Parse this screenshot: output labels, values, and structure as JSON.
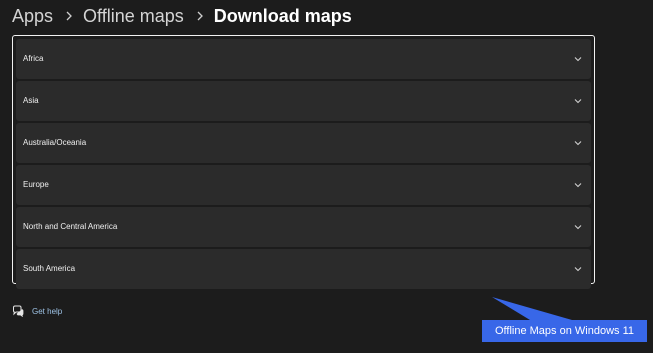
{
  "breadcrumb": {
    "items": [
      {
        "label": "Apps"
      },
      {
        "label": "Offline maps"
      },
      {
        "label": "Download maps"
      }
    ]
  },
  "regions": [
    {
      "label": "Africa"
    },
    {
      "label": "Asia"
    },
    {
      "label": "Australia/Oceania"
    },
    {
      "label": "Europe"
    },
    {
      "label": "North and Central America"
    },
    {
      "label": "South America"
    }
  ],
  "help": {
    "label": "Get help",
    "icon": "chat-help-icon"
  },
  "annotation": {
    "label": "Offline Maps on Windows 11",
    "color": "#3867e8"
  },
  "colors": {
    "background": "#1c1c1c",
    "row": "#2b2b2b",
    "link": "#9ec3e6"
  }
}
